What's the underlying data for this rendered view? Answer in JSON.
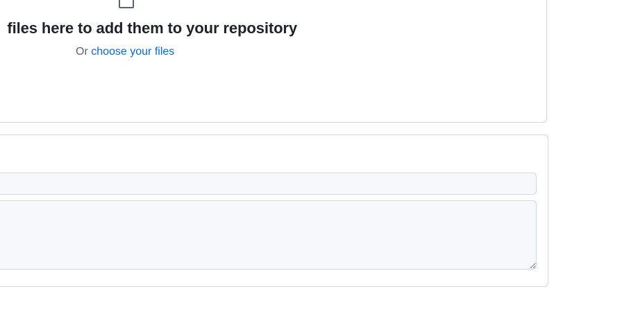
{
  "dropzone": {
    "icon": "file-icon",
    "heading": "files here to add them to your repository",
    "sub_prefix": "Or ",
    "choose_link": "choose your files"
  },
  "commit": {
    "summary_value": "",
    "description_value": ""
  },
  "colors": {
    "link": "#0969da",
    "border": "#d0d7de",
    "input_bg": "#f6f8fa",
    "heading": "#1f2328",
    "muted": "#59636e"
  }
}
